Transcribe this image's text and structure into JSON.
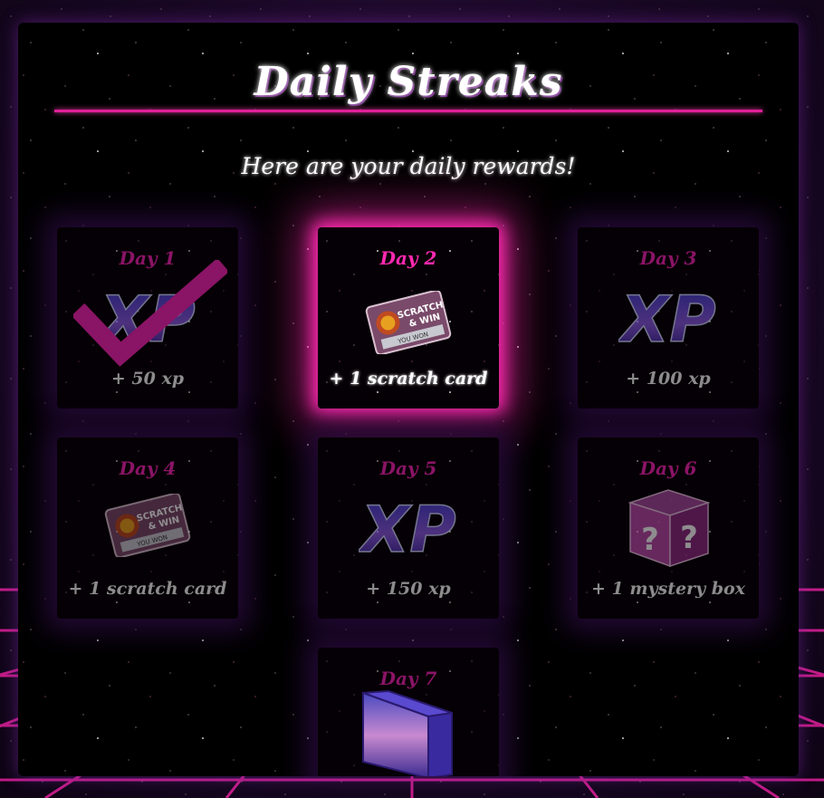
{
  "title": "Daily Streaks",
  "subtitle": "Here are your daily rewards!",
  "days": [
    {
      "day_label": "Day 1",
      "reward": "+ 50 xp",
      "icon": "xp-icon",
      "claimed": true
    },
    {
      "day_label": "Day 2",
      "reward": "+ 1 scratch card",
      "icon": "scratch-card-icon",
      "current": true
    },
    {
      "day_label": "Day 3",
      "reward": "+ 100 xp",
      "icon": "xp-icon"
    },
    {
      "day_label": "Day 4",
      "reward": "+ 1 scratch card",
      "icon": "scratch-card-icon"
    },
    {
      "day_label": "Day 5",
      "reward": "+ 150 xp",
      "icon": "xp-icon"
    },
    {
      "day_label": "Day 6",
      "reward": "+ 1 mystery box",
      "icon": "mystery-box-icon"
    },
    {
      "day_label": "Day 7",
      "reward": "",
      "icon": "cube-icon"
    }
  ],
  "colors": {
    "accent": "#ff2ab0",
    "accent_dim": "#8a1466",
    "panel": "#000000",
    "grid": "#e0209a"
  }
}
